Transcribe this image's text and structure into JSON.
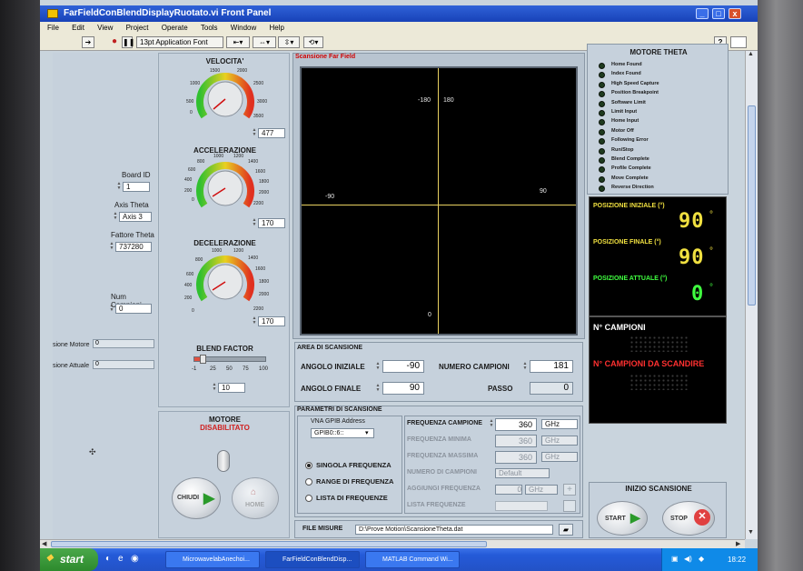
{
  "window": {
    "title": "FarFieldConBlendDisplayRuotato.vi Front Panel",
    "help_icon": "?"
  },
  "menu": [
    "File",
    "Edit",
    "View",
    "Project",
    "Operate",
    "Tools",
    "Window",
    "Help"
  ],
  "toolbar": {
    "font": "13pt Application Font"
  },
  "left": {
    "board_id_label": "Board ID",
    "board_id": "1",
    "axis_theta_label": "Axis Theta",
    "axis_theta": "Axis 3",
    "fattore_theta_label": "Fattore Theta",
    "fattore_theta": "737280",
    "num_campioni_label": "Num Campioni",
    "num_campioni": "0",
    "posizione_motore_label": "sione Motore",
    "posizione_motore": "0",
    "posizione_attuale_label": "sione Attuale",
    "posizione_attuale": "0"
  },
  "knobs": {
    "velocita": {
      "title": "VELOCITA'",
      "value": "477",
      "ticks": [
        "0",
        "500",
        "1000",
        "1500",
        "2000",
        "2500",
        "3000",
        "3500"
      ]
    },
    "accelerazione": {
      "title": "ACCELERAZIONE",
      "value": "170",
      "ticks": [
        "0",
        "200",
        "400",
        "600",
        "800",
        "1000",
        "1200",
        "1400",
        "1600",
        "1800",
        "2000",
        "2200"
      ]
    },
    "decelerazione": {
      "title": "DECELERAZIONE",
      "value": "170",
      "ticks": [
        "0",
        "200",
        "400",
        "600",
        "800",
        "1000",
        "1200",
        "1400",
        "1600",
        "1800",
        "2000",
        "2200"
      ]
    },
    "blend": {
      "title": "BLEND FACTOR",
      "value": "10",
      "ticks": [
        "-1",
        "25",
        "50",
        "75",
        "100"
      ]
    }
  },
  "motore": {
    "title": "MOTORE",
    "status": "DISABILITATO",
    "chiudi": "CHIUDI",
    "home": "HOME"
  },
  "scan": {
    "title": "Scansione Far Field",
    "labels": {
      "top_left": "-180",
      "top_right": "180",
      "left": "-90",
      "right": "90",
      "bottom": "0"
    }
  },
  "area": {
    "title": "AREA DI SCANSIONE",
    "angolo_iniziale_label": "ANGOLO INIZIALE",
    "angolo_iniziale": "-90",
    "angolo_finale_label": "ANGOLO FINALE",
    "angolo_finale": "90",
    "numero_campioni_label": "NUMERO CAMPIONI",
    "numero_campioni": "181",
    "passo_label": "PASSO",
    "passo": "0"
  },
  "params": {
    "title": "PARAMETRI DI SCANSIONE",
    "vna_label": "VNA GPIB Address",
    "vna_value": "GPIB0::6::",
    "radio": [
      "SINGOLA FREQUENZA",
      "RANGE DI FREQUENZA",
      "LISTA DI FREQUENZE"
    ],
    "selected": "SINGOLA FREQUENZA",
    "freq_campione_label": "FREQUENZA CAMPIONE",
    "freq_campione": "360",
    "freq_minima_label": "FREQUENZA MINIMA",
    "freq_minima": "360",
    "freq_massima_label": "FREQUENZA MASSIMA",
    "freq_massima": "360",
    "unit": "GHz",
    "num_campioni_label": "NUMERO DI CAMPIONI",
    "num_campioni": "Default",
    "aggiungi_label": "AGGIUNGI FREQUENZA",
    "aggiungi": "0",
    "lista_label": "LISTA FREQUENZE"
  },
  "file": {
    "label": "FILE MISURE",
    "path": "D:\\Prove Motion\\ScansioneTheta.dat"
  },
  "motore_theta": {
    "title": "MOTORE THETA",
    "leds": [
      "Home Found",
      "Index Found",
      "High Speed Capture",
      "Position Breakpoint",
      "Software Limit",
      "Limit Input",
      "Home Input",
      "Motor Off",
      "Following Error",
      "Run/Stop",
      "Blend Complete",
      "Profile Complete",
      "Move Complete",
      "Reverse Direction"
    ]
  },
  "posizioni": {
    "iniziale_label": "POSIZIONE INIZIALE (°)",
    "iniziale": "90",
    "finale_label": "POSIZIONE FINALE (°)",
    "finale": "90",
    "attuale_label": "POSIZIONE ATTUALE (°)",
    "attuale": "0",
    "degree": "°"
  },
  "campioni": {
    "n_label": "N° CAMPIONI",
    "da_scandire_label": "N° CAMPIONI DA SCANDIRE"
  },
  "inizio": {
    "title": "INIZIO SCANSIONE",
    "start": "START",
    "stop": "STOP"
  },
  "taskbar": {
    "start": "start",
    "tasks": [
      "MicrowavelabAnechoi...",
      "FarFieldConBlendDisp...",
      "MATLAB Command Wi..."
    ],
    "clock": "18:22"
  },
  "colors": {
    "title_bar": "#1842b8",
    "panel": "#c6d1dc",
    "graph_bg": "#000000",
    "axis": "#e8d060",
    "led_yellow": "#f0e040",
    "led_green": "#40ff40",
    "alarm_red": "#ff3030"
  }
}
